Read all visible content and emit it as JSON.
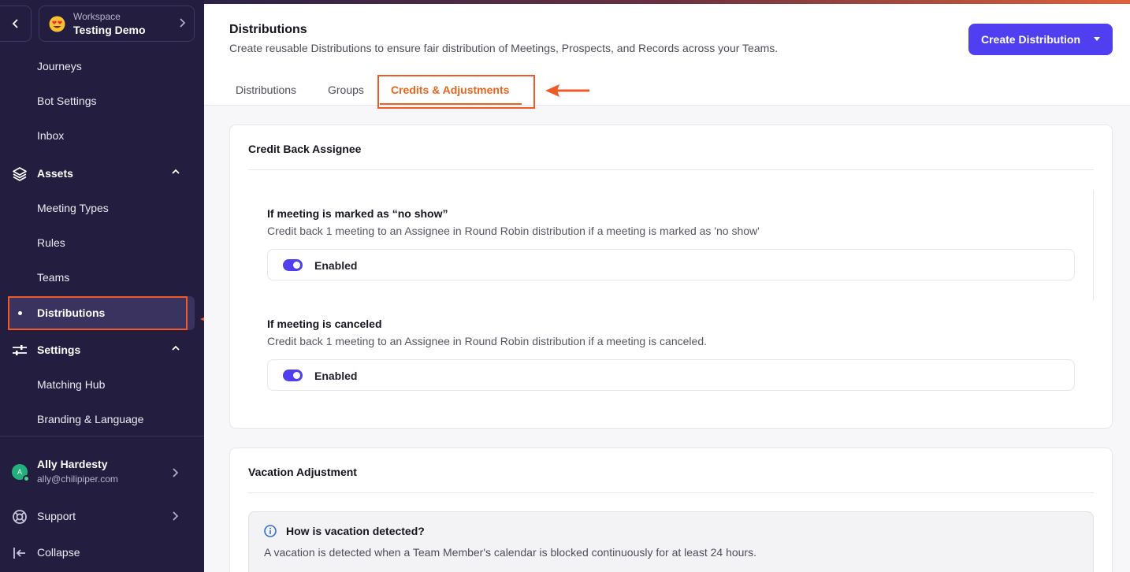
{
  "workspace": {
    "label": "Workspace",
    "name": "Testing Demo"
  },
  "sidebar": {
    "items_top": [
      "Journeys",
      "Bot Settings",
      "Inbox"
    ],
    "assets": {
      "label": "Assets",
      "items": [
        "Meeting Types",
        "Rules",
        "Teams",
        "Distributions"
      ]
    },
    "settings": {
      "label": "Settings",
      "items": [
        "Matching Hub",
        "Branding & Language"
      ]
    }
  },
  "user": {
    "initial": "A",
    "name": "Ally Hardesty",
    "email": "ally@chilipiper.com"
  },
  "footer": {
    "support": "Support",
    "collapse": "Collapse"
  },
  "page": {
    "title": "Distributions",
    "subtitle": "Create reusable Distributions to ensure fair distribution of Meetings, Prospects, and Records across your Teams.",
    "create_button": "Create Distribution",
    "tabs": [
      "Distributions",
      "Groups",
      "Credits & Adjustments"
    ]
  },
  "credit_back": {
    "title": "Credit Back Assignee",
    "options": [
      {
        "title": "If meeting is marked as “no show”",
        "desc": "Credit back 1 meeting to an Assignee in Round Robin distribution if a meeting is marked as 'no show'",
        "toggle": "Enabled"
      },
      {
        "title": "If meeting is canceled",
        "desc": "Credit back 1 meeting to an Assignee in Round Robin distribution if a meeting is canceled.",
        "toggle": "Enabled"
      }
    ]
  },
  "vacation": {
    "title": "Vacation Adjustment",
    "info_title": "How is vacation detected?",
    "info_text": "A vacation is detected when a Team Member's calendar is blocked continuously for at least 24 hours."
  },
  "colors": {
    "accent": "#4f3ff0",
    "highlight": "#f05a28",
    "active_tab": "#e8651e",
    "sidebar_bg": "#231d3f"
  }
}
